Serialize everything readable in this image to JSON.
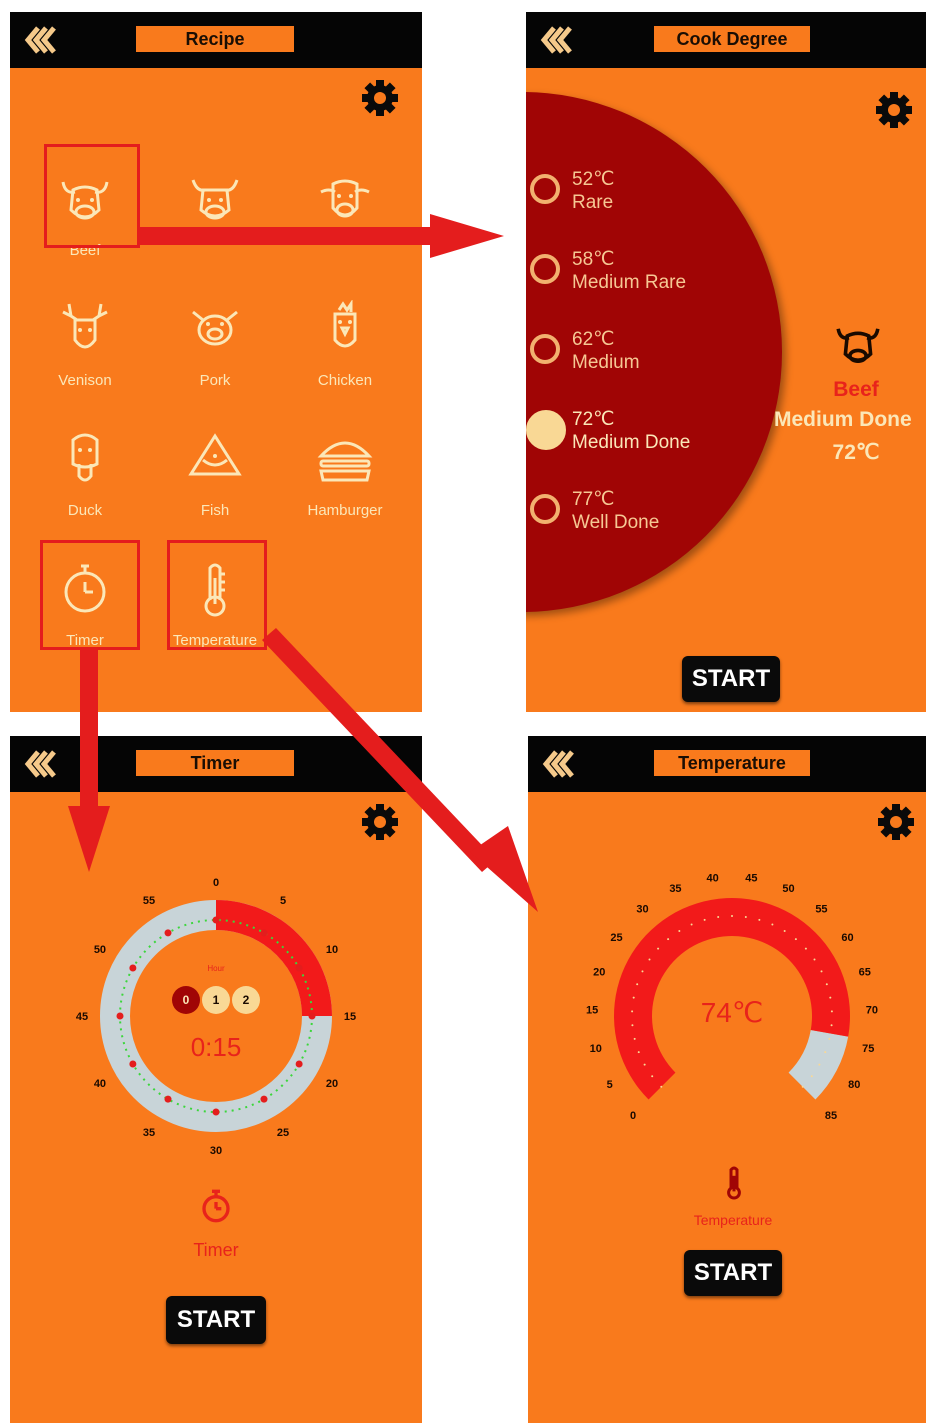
{
  "screens": {
    "recipe": {
      "title": "Recipe",
      "items": [
        {
          "label": "Beef",
          "icon": "beef-icon"
        },
        {
          "label": "",
          "icon": "bull-icon"
        },
        {
          "label": "",
          "icon": "cow-icon"
        },
        {
          "label": "Venison",
          "icon": "deer-icon"
        },
        {
          "label": "Pork",
          "icon": "pig-icon"
        },
        {
          "label": "Chicken",
          "icon": "chicken-icon"
        },
        {
          "label": "Duck",
          "icon": "duck-icon"
        },
        {
          "label": "Fish",
          "icon": "fish-icon"
        },
        {
          "label": "Hamburger",
          "icon": "hamburger-icon"
        },
        {
          "label": "Timer",
          "icon": "stopwatch-icon"
        },
        {
          "label": "Temperature",
          "icon": "thermometer-icon"
        }
      ]
    },
    "cook_degree": {
      "title": "Cook Degree",
      "options": [
        {
          "temp": "52℃",
          "name": "Rare",
          "selected": false
        },
        {
          "temp": "58℃",
          "name": "Medium Rare",
          "selected": false
        },
        {
          "temp": "62℃",
          "name": "Medium",
          "selected": false
        },
        {
          "temp": "72℃",
          "name": "Medium Done",
          "selected": true
        },
        {
          "temp": "77℃",
          "name": "Well Done",
          "selected": false
        }
      ],
      "summary": {
        "meat": "Beef",
        "degree": "Medium Done",
        "temp": "72℃"
      },
      "start_label": "START"
    },
    "timer": {
      "title": "Timer",
      "dial_ticks": [
        "0",
        "5",
        "10",
        "15",
        "20",
        "25",
        "30",
        "35",
        "40",
        "45",
        "50",
        "55"
      ],
      "hour_label": "Hour",
      "hour_options": [
        "0",
        "1",
        "2"
      ],
      "selected_hour": "0",
      "time_display": "0:15",
      "elapsed_fraction": 0.25,
      "caption": "Timer",
      "start_label": "START"
    },
    "temperature": {
      "title": "Temperature",
      "gauge_ticks": [
        "0",
        "5",
        "10",
        "15",
        "20",
        "25",
        "30",
        "35",
        "40",
        "45",
        "50",
        "55",
        "60",
        "65",
        "70",
        "75",
        "80",
        "85"
      ],
      "reading": "74℃",
      "reading_value": 74,
      "gauge_max": 85,
      "caption": "Temperature",
      "start_label": "START"
    }
  },
  "colors": {
    "panel": "#f97a1c",
    "bar": "#050505",
    "accent_red": "#e8231b",
    "deep_red": "#a00505",
    "cream": "#fbe7b8",
    "highlight": "#e41d1d"
  }
}
